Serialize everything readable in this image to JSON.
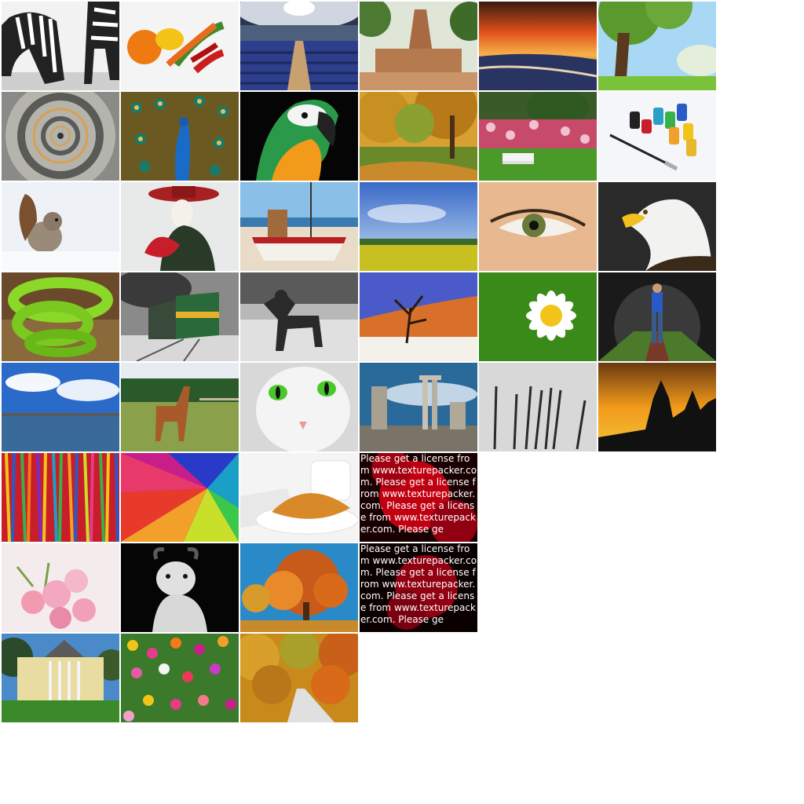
{
  "tiles": [
    {
      "id": "zebra",
      "subject": "zebra-photo"
    },
    {
      "id": "peppers",
      "subject": "peppers-photo"
    },
    {
      "id": "theater",
      "subject": "theater-photo"
    },
    {
      "id": "temple",
      "subject": "temple-ruins-photo"
    },
    {
      "id": "sunset-beach",
      "subject": "sunset-beach-photo"
    },
    {
      "id": "tree-meadow",
      "subject": "tree-meadow-photo"
    },
    {
      "id": "spiral-stairs",
      "subject": "spiral-staircase-photo"
    },
    {
      "id": "peacock",
      "subject": "peacock-photo"
    },
    {
      "id": "parrot",
      "subject": "parrot-photo"
    },
    {
      "id": "autumn-park",
      "subject": "autumn-park-photo"
    },
    {
      "id": "garden-bench",
      "subject": "garden-bench-photo"
    },
    {
      "id": "paint-pots",
      "subject": "paint-pots-photo"
    },
    {
      "id": "squirrel",
      "subject": "squirrel-photo"
    },
    {
      "id": "carnival",
      "subject": "carnival-mask-photo"
    },
    {
      "id": "boat",
      "subject": "boat-photo"
    },
    {
      "id": "rapeseed-field",
      "subject": "rapeseed-field-photo"
    },
    {
      "id": "eye",
      "subject": "eye-photo"
    },
    {
      "id": "eagle",
      "subject": "eagle-photo"
    },
    {
      "id": "snake",
      "subject": "green-snake-photo"
    },
    {
      "id": "train",
      "subject": "train-photo"
    },
    {
      "id": "dog",
      "subject": "dog-photo"
    },
    {
      "id": "desert",
      "subject": "desert-tree-photo"
    },
    {
      "id": "daisy",
      "subject": "daisy-photo"
    },
    {
      "id": "tunnel",
      "subject": "tunnel-hiker-photo"
    },
    {
      "id": "pier",
      "subject": "pier-sky-photo"
    },
    {
      "id": "horse",
      "subject": "horse-photo"
    },
    {
      "id": "cat",
      "subject": "white-cat-photo"
    },
    {
      "id": "ruins",
      "subject": "greek-ruins-photo"
    },
    {
      "id": "brushes",
      "subject": "paint-brushes-photo"
    },
    {
      "id": "castle",
      "subject": "castle-silhouette-photo"
    },
    {
      "id": "colored-strings",
      "subject": "colored-strings-photo"
    },
    {
      "id": "color-wheel",
      "subject": "color-wheel-photo"
    },
    {
      "id": "croissant",
      "subject": "croissant-photo"
    },
    {
      "id": "watermark-1",
      "subject": "license-watermark-red"
    },
    {
      "id": "roses",
      "subject": "roses-photo"
    },
    {
      "id": "goat",
      "subject": "goat-photo"
    },
    {
      "id": "autumn-tree",
      "subject": "autumn-tree-photo"
    },
    {
      "id": "watermark-2",
      "subject": "license-watermark-dark"
    },
    {
      "id": "mansion",
      "subject": "mansion-photo"
    },
    {
      "id": "flower-field",
      "subject": "flower-field-photo"
    },
    {
      "id": "autumn-road",
      "subject": "autumn-road-photo"
    }
  ],
  "watermarks": {
    "w1": "Please get a license from www.texturepacker.com. Please get a license from www.texturepacker.com. Please get a license from www.texturepacker.com. Please ge",
    "w2": "Please get a license from www.texturepacker.com. Please get a license from www.texturepacker.com. Please get a license from www.texturepacker.com. Please ge"
  },
  "colors": {
    "background": "#ffffff",
    "watermark_red": "#c00010",
    "watermark_dark": "#1a0000",
    "watermark_text": "#ffffff"
  }
}
